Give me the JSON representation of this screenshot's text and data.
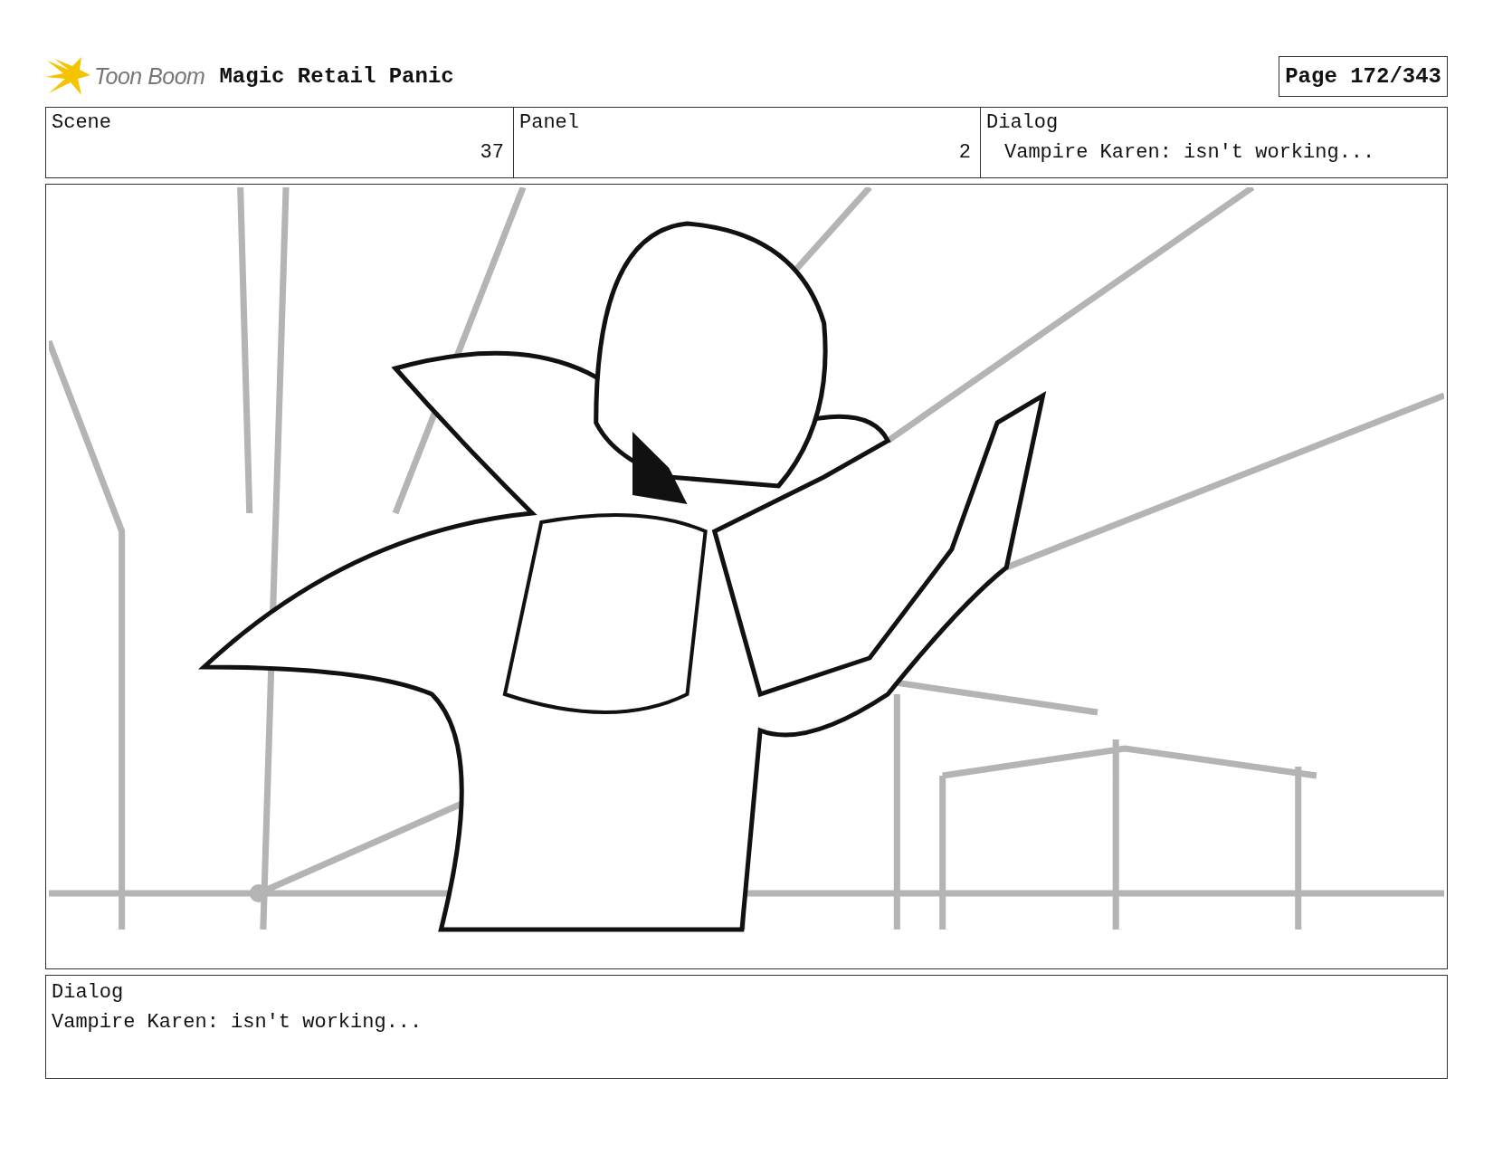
{
  "header": {
    "logo_text": "Toon Boom",
    "title": "Magic Retail Panic",
    "page": "Page 172/343"
  },
  "info_table": {
    "columns": [
      "Scene",
      "Panel",
      "Dialog"
    ],
    "row": [
      "37",
      "2",
      "Vampire Karen: isn't working..."
    ]
  },
  "dialog": {
    "label": "Dialog",
    "text": "Vampire Karen: isn't working..."
  }
}
